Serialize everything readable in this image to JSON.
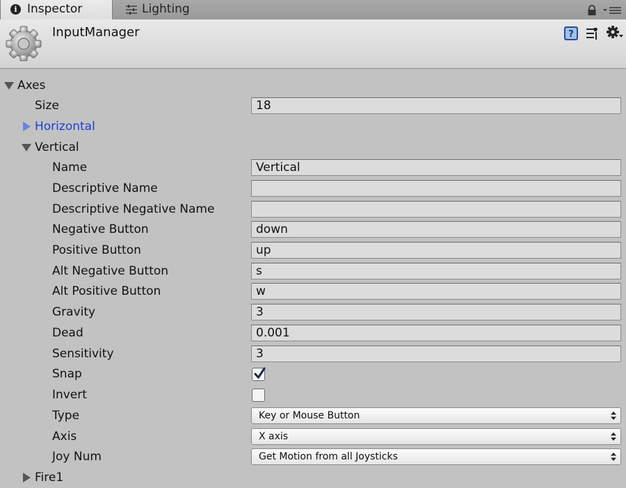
{
  "tabs": [
    {
      "label": "Inspector",
      "icon": "info-icon",
      "active": true
    },
    {
      "label": "Lighting",
      "icon": "lighting-icon",
      "active": false
    }
  ],
  "header": {
    "title": "InputManager",
    "icon": "gear-icon"
  },
  "axes": {
    "label": "Axes",
    "size_label": "Size",
    "size_value": "18",
    "horizontal_label": "Horizontal",
    "vertical": {
      "label": "Vertical",
      "fields": {
        "name": {
          "label": "Name",
          "value": "Vertical"
        },
        "descriptive_name": {
          "label": "Descriptive Name",
          "value": ""
        },
        "descriptive_negative_name": {
          "label": "Descriptive Negative Name",
          "value": ""
        },
        "negative_button": {
          "label": "Negative Button",
          "value": "down"
        },
        "positive_button": {
          "label": "Positive Button",
          "value": "up"
        },
        "alt_negative_button": {
          "label": "Alt Negative Button",
          "value": "s"
        },
        "alt_positive_button": {
          "label": "Alt Positive Button",
          "value": "w"
        },
        "gravity": {
          "label": "Gravity",
          "value": "3"
        },
        "dead": {
          "label": "Dead",
          "value": "0.001"
        },
        "sensitivity": {
          "label": "Sensitivity",
          "value": "3"
        },
        "snap": {
          "label": "Snap",
          "checked": true
        },
        "invert": {
          "label": "Invert",
          "checked": false
        },
        "type": {
          "label": "Type",
          "value": "Key or Mouse Button"
        },
        "axis": {
          "label": "Axis",
          "value": "X axis"
        },
        "joy_num": {
          "label": "Joy Num",
          "value": "Get Motion from all Joysticks"
        }
      }
    },
    "fire1_label": "Fire1"
  }
}
